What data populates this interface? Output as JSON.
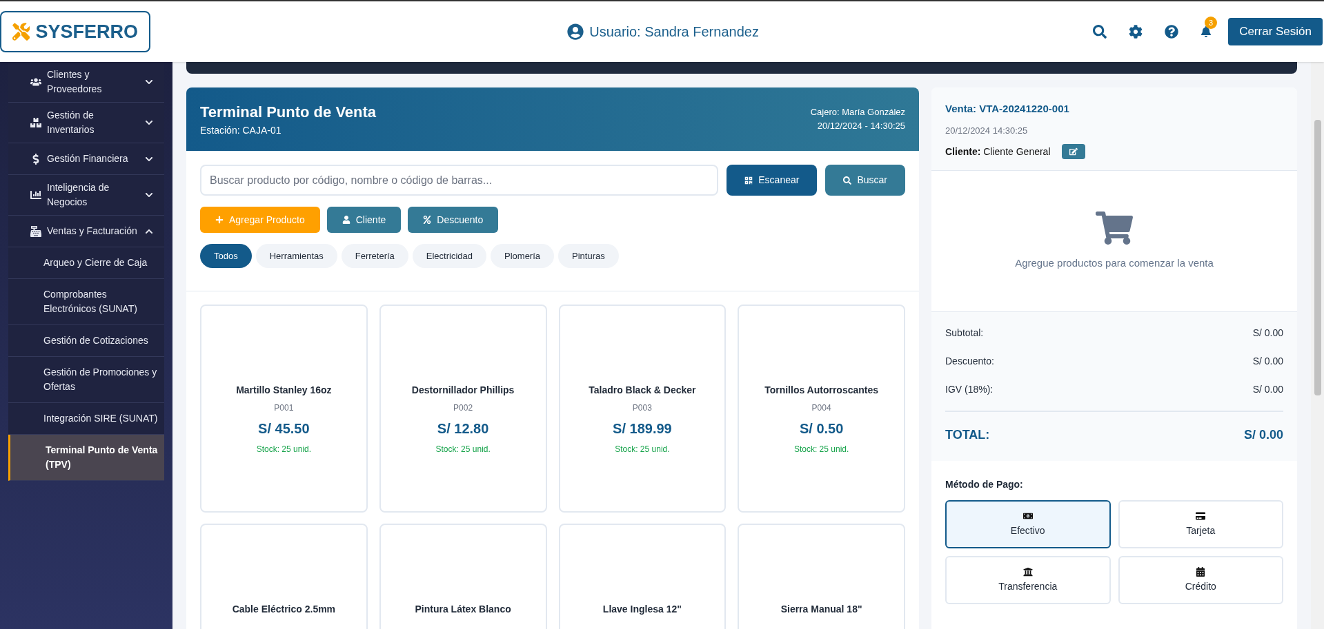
{
  "header": {
    "logo": "SYSFERRO",
    "user": "Usuario: Sandra Fernandez",
    "notifications": "3",
    "logout": "Cerrar Sesión"
  },
  "sidebar": {
    "items": [
      {
        "label": "Clientes y Proveedores",
        "expanded": false
      },
      {
        "label": "Gestión de Inventarios",
        "expanded": false
      },
      {
        "label": "Gestión Financiera",
        "expanded": false
      },
      {
        "label": "Inteligencia de Negocios",
        "expanded": false
      },
      {
        "label": "Ventas y Facturación",
        "expanded": true,
        "children": [
          {
            "label": "Arqueo y Cierre de Caja",
            "selected": false
          },
          {
            "label": "Comprobantes Electrónicos (SUNAT)",
            "selected": false
          },
          {
            "label": "Gestión de Cotizaciones",
            "selected": false
          },
          {
            "label": "Gestión de Promociones y Ofertas",
            "selected": false
          },
          {
            "label": "Integración SIRE (SUNAT)",
            "selected": false
          },
          {
            "label": "Terminal Punto de Venta (TPV)",
            "selected": true
          }
        ]
      }
    ]
  },
  "pos": {
    "title": "Terminal Punto de Venta",
    "station": "Estación: CAJA-01",
    "cashier": "Cajero: María González",
    "datetime": "20/12/2024 - 14:30:25",
    "search": {
      "placeholder": "Buscar producto por código, nombre o código de barras..."
    },
    "search_buttons": [
      "Escanear",
      "Buscar"
    ],
    "actions": [
      {
        "label": "Agregar Producto",
        "kind": "add"
      },
      {
        "label": "Cliente",
        "kind": "client"
      },
      {
        "label": "Descuento",
        "kind": "discount"
      }
    ],
    "categories": [
      {
        "label": "Todos",
        "selected": true
      },
      {
        "label": "Herramientas",
        "selected": false
      },
      {
        "label": "Ferretería",
        "selected": false
      },
      {
        "label": "Electricidad",
        "selected": false
      },
      {
        "label": "Plomería",
        "selected": false
      },
      {
        "label": "Pinturas",
        "selected": false
      }
    ],
    "products": [
      {
        "name": "Martillo Stanley 16oz",
        "code": "P001",
        "price": "S/ 45.50",
        "stock": "Stock: 25 unid."
      },
      {
        "name": "Destornillador Phillips",
        "code": "P002",
        "price": "S/ 12.80",
        "stock": "Stock: 25 unid."
      },
      {
        "name": "Taladro Black & Decker",
        "code": "P003",
        "price": "S/ 189.99",
        "stock": "Stock: 25 unid."
      },
      {
        "name": "Tornillos Autorroscantes",
        "code": "P004",
        "price": "S/ 0.50",
        "stock": "Stock: 25 unid."
      },
      {
        "name": "Cable Eléctrico 2.5mm"
      },
      {
        "name": "Pintura Látex Blanco"
      },
      {
        "name": "Llave Inglesa 12\""
      },
      {
        "name": "Sierra Manual 18\""
      }
    ]
  },
  "sale": {
    "title": "Venta: VTA-20241220-001",
    "datetime": "20/12/2024 14:30:25",
    "client_label": "Cliente:",
    "client": "Cliente General",
    "empty": "Agregue productos para comenzar la venta",
    "totals": [
      {
        "label": "Subtotal:",
        "value": "S/ 0.00"
      },
      {
        "label": "Descuento:",
        "value": "S/ 0.00"
      },
      {
        "label": "IGV (18%):",
        "value": "S/ 0.00"
      }
    ],
    "total": {
      "label": "TOTAL:",
      "value": "S/ 0.00"
    },
    "payment_title": "Método de Pago:",
    "payment_methods": [
      {
        "label": "Efectivo",
        "kind": "cash",
        "selected": true
      },
      {
        "label": "Tarjeta",
        "kind": "card",
        "selected": false
      },
      {
        "label": "Transferencia",
        "kind": "transfer",
        "selected": false
      },
      {
        "label": "Crédito",
        "kind": "credit",
        "selected": false
      }
    ]
  }
}
